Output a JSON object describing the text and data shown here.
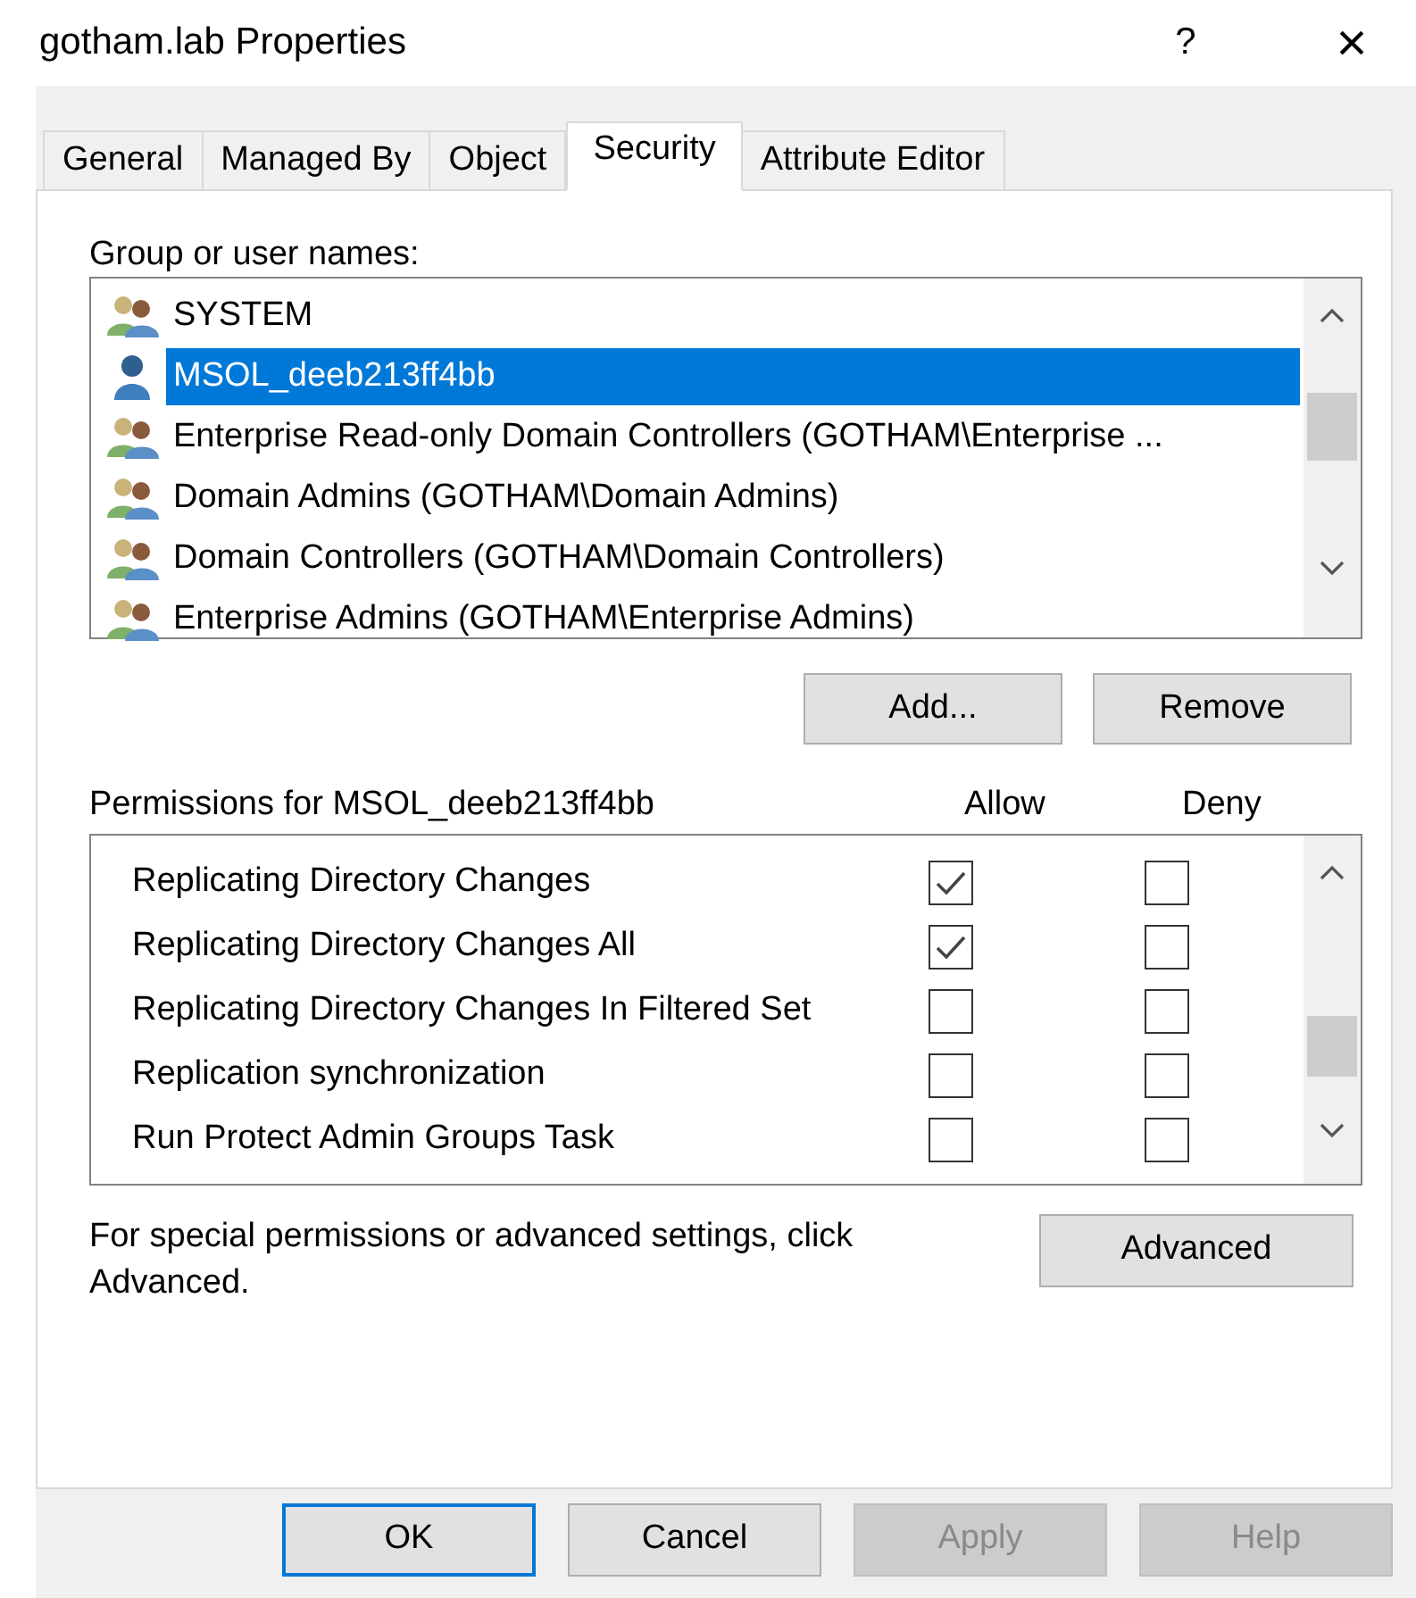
{
  "window": {
    "title": "gotham.lab Properties",
    "help": "?",
    "close": "×"
  },
  "tabs": [
    {
      "label": "General",
      "selected": false
    },
    {
      "label": "Managed By",
      "selected": false
    },
    {
      "label": "Object",
      "selected": false
    },
    {
      "label": "Security",
      "selected": true
    },
    {
      "label": "Attribute Editor",
      "selected": false
    }
  ],
  "names_label": "Group or user names:",
  "principals": [
    {
      "kind": "group",
      "name": "SYSTEM",
      "selected": false
    },
    {
      "kind": "user",
      "name": "MSOL_deeb213ff4bb",
      "selected": true
    },
    {
      "kind": "group",
      "name": "Enterprise Read-only Domain Controllers (GOTHAM\\Enterprise ...",
      "selected": false
    },
    {
      "kind": "group",
      "name": "Domain Admins (GOTHAM\\Domain Admins)",
      "selected": false
    },
    {
      "kind": "group",
      "name": "Domain Controllers (GOTHAM\\Domain Controllers)",
      "selected": false
    },
    {
      "kind": "group",
      "name": "Enterprise Admins (GOTHAM\\Enterprise Admins)",
      "selected": false
    }
  ],
  "principal_buttons": [
    "Add...",
    "Remove"
  ],
  "permissions_label": "Permissions for MSOL_deeb213ff4bb",
  "columns": [
    "Allow",
    "Deny"
  ],
  "permissions": [
    {
      "name": "Replicating Directory Changes",
      "allow": true,
      "deny": false
    },
    {
      "name": "Replicating Directory Changes All",
      "allow": true,
      "deny": false
    },
    {
      "name": "Replicating Directory Changes In Filtered Set",
      "allow": false,
      "deny": false
    },
    {
      "name": "Replication synchronization",
      "allow": false,
      "deny": false
    },
    {
      "name": "Run Protect Admin Groups Task",
      "allow": false,
      "deny": false
    }
  ],
  "advanced_note": "For special permissions or advanced settings, click Advanced.",
  "advanced_button": "Advanced",
  "buttons": [
    {
      "label": "OK",
      "default": true,
      "disabled": false
    },
    {
      "label": "Cancel",
      "default": false,
      "disabled": false
    },
    {
      "label": "Apply",
      "default": false,
      "disabled": true
    },
    {
      "label": "Help",
      "default": false,
      "disabled": true
    }
  ]
}
